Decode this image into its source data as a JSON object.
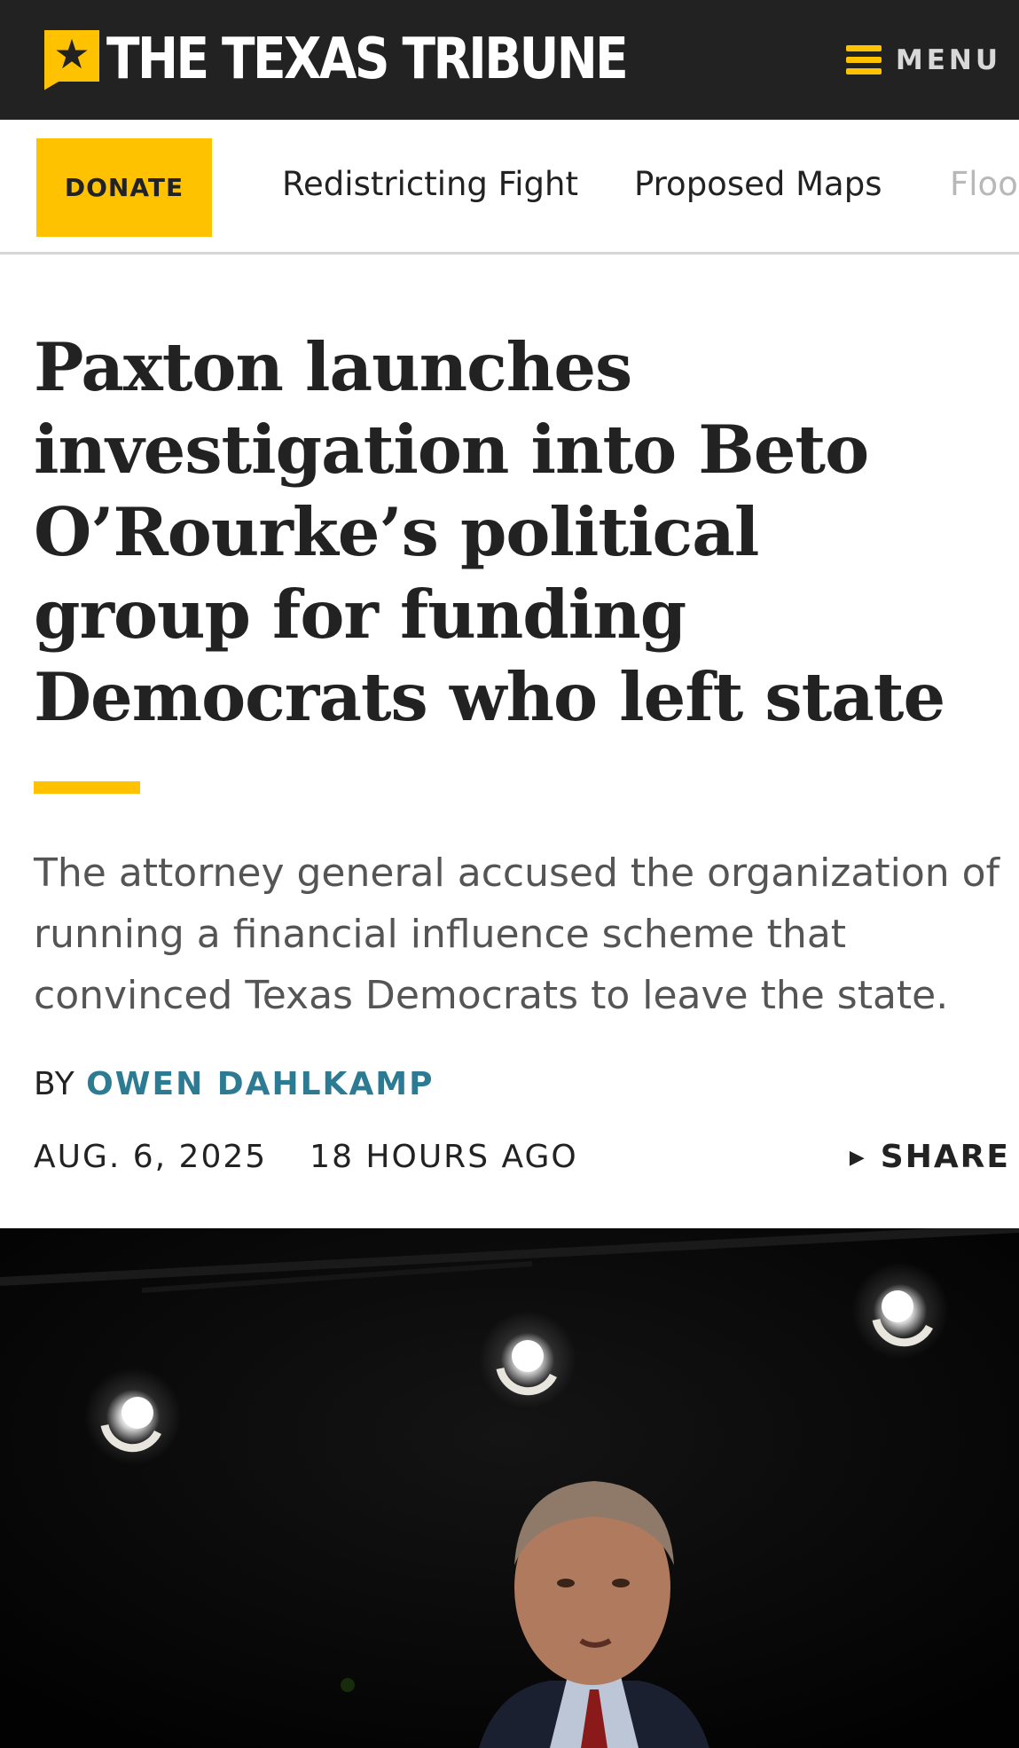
{
  "header": {
    "logo_text": "THE TEXAS TRIBUNE",
    "menu_label": "MENU",
    "colors": {
      "background": "#222222",
      "accent": "#ffc200"
    }
  },
  "nav": {
    "donate_label": "DONATE",
    "links": [
      "Redistricting Fight",
      "Proposed Maps",
      "Floo"
    ]
  },
  "article": {
    "headline": "Paxton launches investigation into Beto O’Rourke’s political group for funding Democrats who left state",
    "dek": "The attorney general accused the organization of running a financial influence scheme that convinced Texas Democrats to leave the state.",
    "byline_prefix": "BY",
    "author": "OWEN DAHLKAMP",
    "date": "AUG. 6, 2025",
    "relative_time": "18 HOURS AGO",
    "share_label": "SHARE",
    "author_color": "#2d7a93"
  },
  "photo": {
    "subject": "man speaking under stage lights",
    "icons": [
      "star-icon",
      "menu-icon",
      "triangle-right-icon"
    ]
  }
}
